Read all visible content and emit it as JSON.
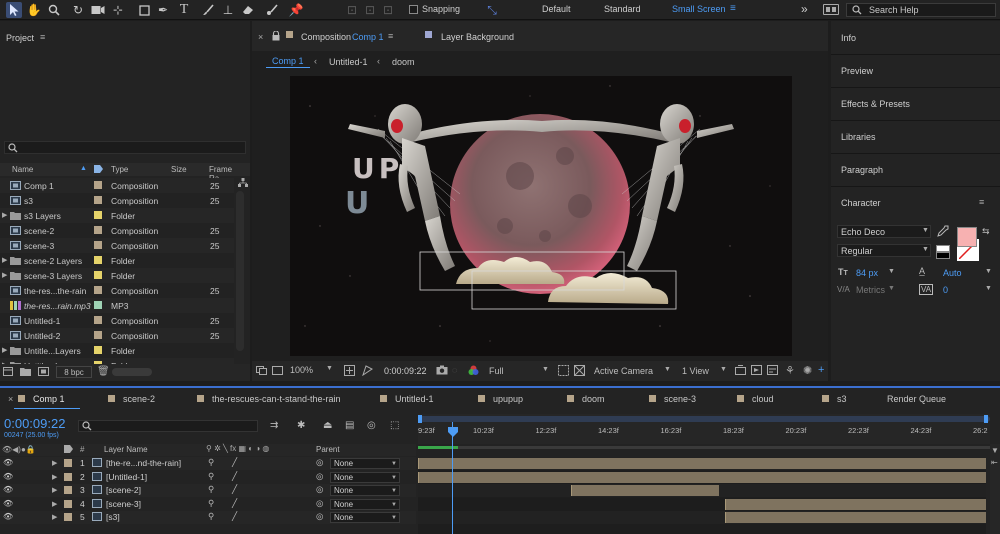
{
  "toolbar": {
    "snapping_label": "Snapping",
    "workspaces": [
      "Default",
      "Standard",
      "Small Screen"
    ],
    "active_workspace": "Small Screen",
    "search_placeholder": "Search Help",
    "more": "»"
  },
  "project": {
    "title": "Project",
    "search_icon": "search-icon",
    "columns": {
      "name": "Name",
      "type": "Type",
      "size": "Size",
      "frame_rate": "Frame Ra..."
    },
    "items": [
      {
        "name": "Comp 1",
        "type": "Composition",
        "fr": "25",
        "kind": "comp",
        "color": "#b5a48a",
        "expand": false
      },
      {
        "name": "s3",
        "type": "Composition",
        "fr": "25",
        "kind": "comp",
        "color": "#b5a48a",
        "expand": false
      },
      {
        "name": "s3 Layers",
        "type": "Folder",
        "fr": "",
        "kind": "folder",
        "color": "#e5d36a",
        "expand": true
      },
      {
        "name": "scene-2",
        "type": "Composition",
        "fr": "25",
        "kind": "comp",
        "color": "#b5a48a",
        "expand": false
      },
      {
        "name": "scene-3",
        "type": "Composition",
        "fr": "25",
        "kind": "comp",
        "color": "#b5a48a",
        "expand": false
      },
      {
        "name": "scene-2 Layers",
        "type": "Folder",
        "fr": "",
        "kind": "folder",
        "color": "#e5d36a",
        "expand": true
      },
      {
        "name": "scene-3 Layers",
        "type": "Folder",
        "fr": "",
        "kind": "folder",
        "color": "#e5d36a",
        "expand": true
      },
      {
        "name": "the-res...the-rain",
        "type": "Composition",
        "fr": "25",
        "kind": "comp",
        "color": "#b5a48a",
        "expand": false
      },
      {
        "name": "the-res...rain.mp3",
        "type": "MP3",
        "fr": "",
        "kind": "audio",
        "color": "#9fd3b5",
        "expand": false
      },
      {
        "name": "Untitled-1",
        "type": "Composition",
        "fr": "25",
        "kind": "comp",
        "color": "#b5a48a",
        "expand": false
      },
      {
        "name": "Untitled-2",
        "type": "Composition",
        "fr": "25",
        "kind": "comp",
        "color": "#b5a48a",
        "expand": false
      },
      {
        "name": "Untitle...Layers",
        "type": "Folder",
        "fr": "",
        "kind": "folder",
        "color": "#e5d36a",
        "expand": true
      },
      {
        "name": "Untitle...Layers",
        "type": "Folder",
        "fr": "",
        "kind": "folder",
        "color": "#e5d36a",
        "expand": true
      }
    ],
    "bpc": "8 bpc"
  },
  "viewer": {
    "tab_prefix": "Composition",
    "tab_comp": "Comp 1",
    "layer_tab": "Layer Background",
    "breadcrumbs": [
      "Comp 1",
      "Untitled-1",
      "doom"
    ],
    "zoom": "100%",
    "timecode": "0:00:09:22",
    "resolution": "Full",
    "camera": "Active Camera",
    "view": "1 View",
    "artwork_text": [
      "UP",
      "U"
    ]
  },
  "right_panels": {
    "items": [
      "Info",
      "Preview",
      "Effects & Presets",
      "Libraries",
      "Paragraph"
    ],
    "character": {
      "title": "Character",
      "font": "Echo Deco",
      "style": "Regular",
      "size": "84 px",
      "leading": "Auto",
      "kerning": "Metrics",
      "tracking": "0",
      "fill_color": "#f7b1b1"
    }
  },
  "timeline": {
    "tabs": [
      {
        "label": "Comp 1",
        "color": "#b5a48a"
      },
      {
        "label": "scene-2",
        "color": "#b5a48a"
      },
      {
        "label": "the-rescues-can-t-stand-the-rain",
        "color": "#b5a48a"
      },
      {
        "label": "Untitled-1",
        "color": "#b5a48a"
      },
      {
        "label": "upupup",
        "color": "#b5a48a"
      },
      {
        "label": "doom",
        "color": "#b5a48a"
      },
      {
        "label": "scene-3",
        "color": "#b5a48a"
      },
      {
        "label": "cloud",
        "color": "#b5a48a"
      },
      {
        "label": "s3",
        "color": "#b5a48a"
      }
    ],
    "render_queue": "Render Queue",
    "timecode": "0:00:09:22",
    "frames": "00247 (25.00 fps)",
    "col_layer_name": "Layer Name",
    "col_parent": "Parent",
    "ruler": [
      "9:23f",
      "10:23f",
      "12:23f",
      "14:23f",
      "16:23f",
      "18:23f",
      "20:23f",
      "22:23f",
      "24:23f",
      "26:2"
    ],
    "layers": [
      {
        "num": "1",
        "name": "[the-re...nd-the-rain]",
        "parent": "None",
        "bar_start": 0.0,
        "bar_end": 1.0,
        "eye": true
      },
      {
        "num": "2",
        "name": "[Untitled-1]",
        "parent": "None",
        "bar_start": 0.0,
        "bar_end": 1.0,
        "eye": true
      },
      {
        "num": "3",
        "name": "[scene-2]",
        "parent": "None",
        "bar_start": 0.27,
        "bar_end": 0.53,
        "eye": true
      },
      {
        "num": "4",
        "name": "[scene-3]",
        "parent": "None",
        "bar_start": 0.54,
        "bar_end": 1.0,
        "eye": true
      },
      {
        "num": "5",
        "name": "[s3]",
        "parent": "None",
        "bar_start": 0.54,
        "bar_end": 1.0,
        "eye": true
      }
    ]
  }
}
